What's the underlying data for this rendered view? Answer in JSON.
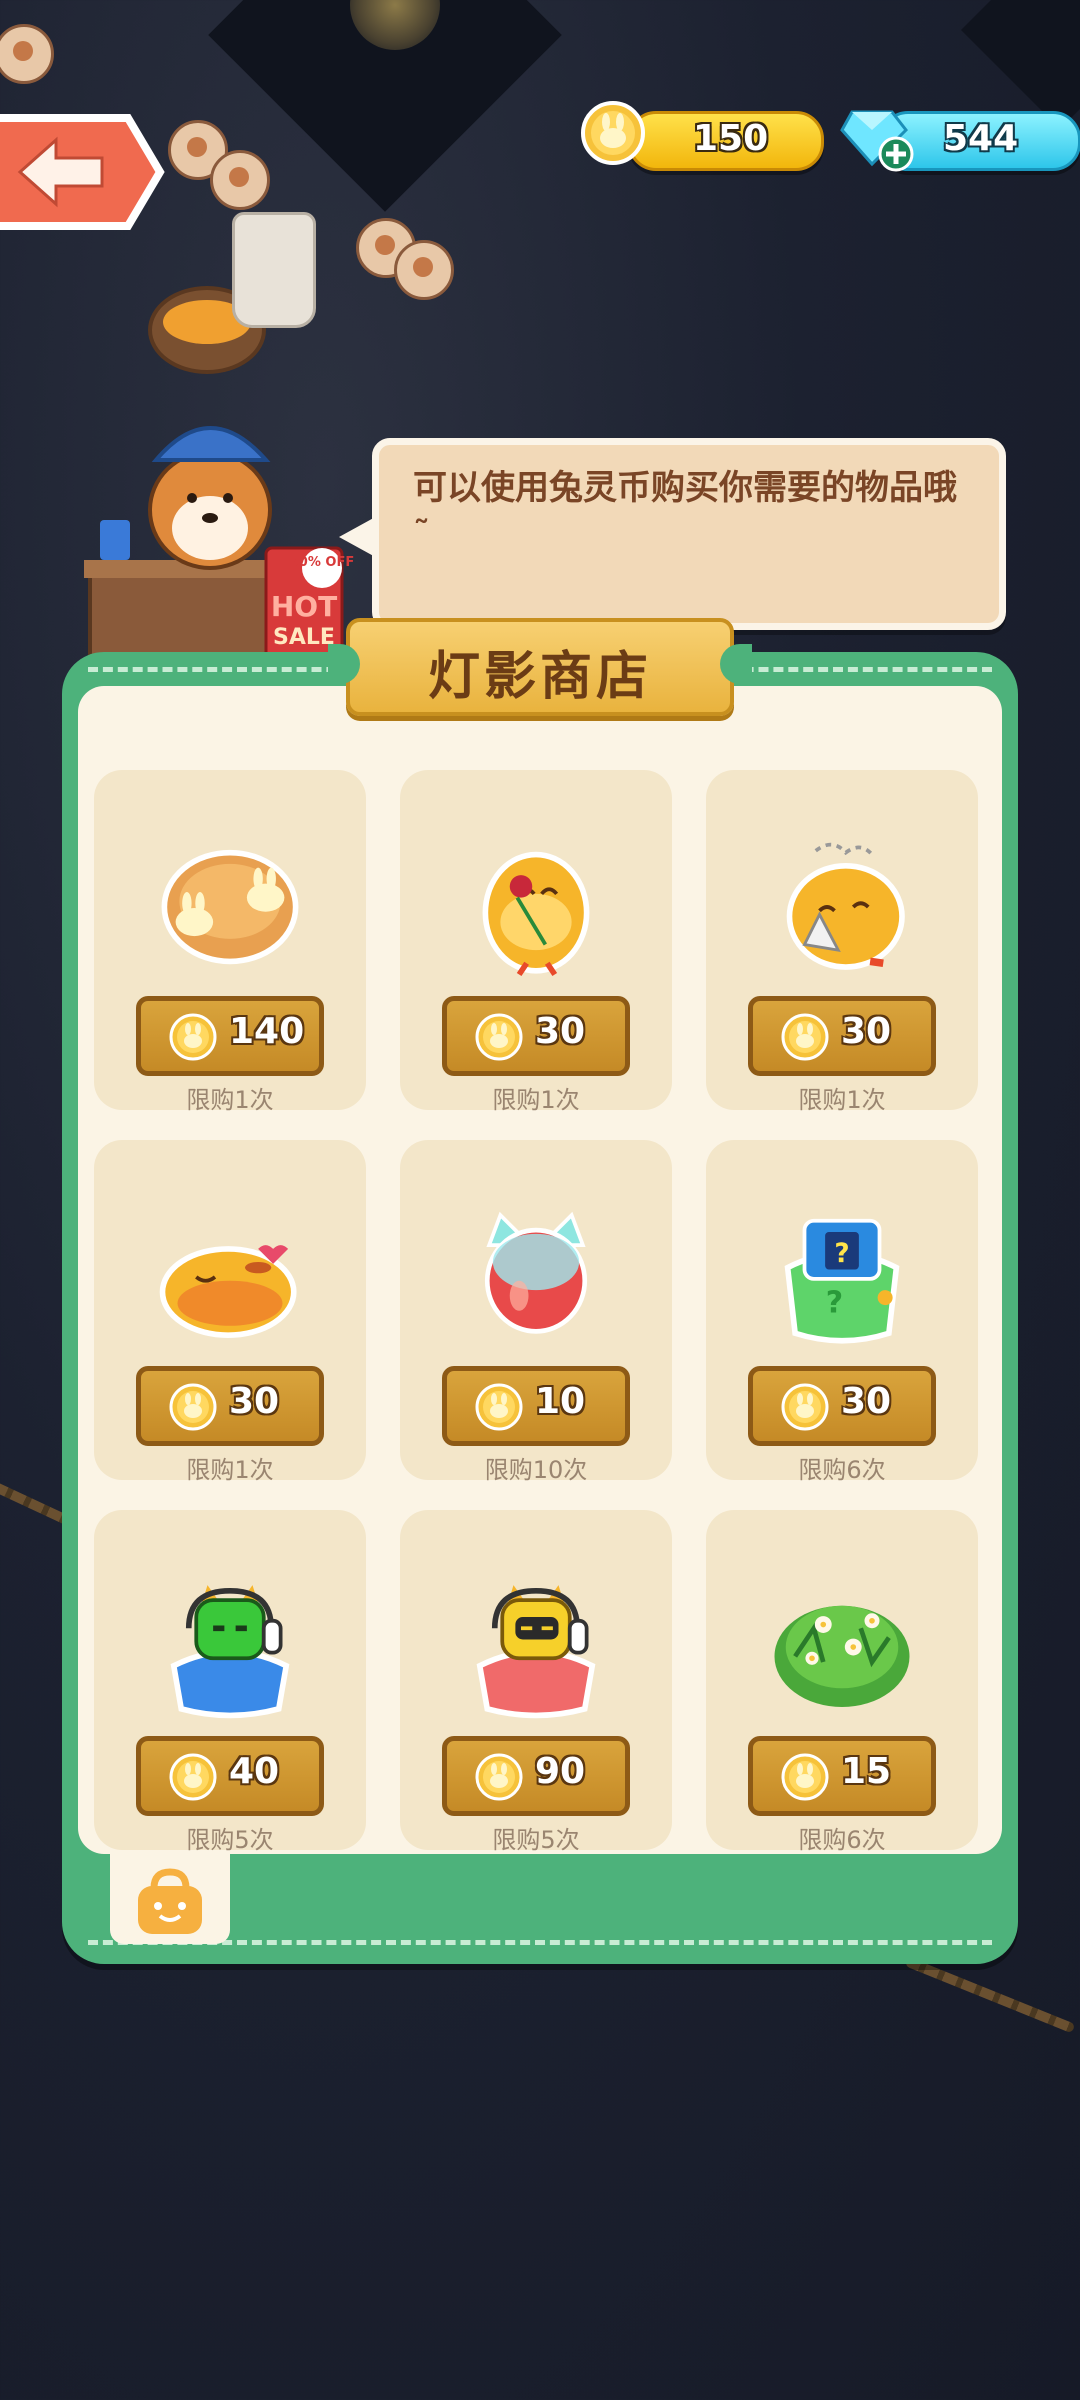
{
  "header": {
    "coins": "150",
    "gems": "544",
    "back_icon": "left-arrow-icon"
  },
  "shopkeeper": {
    "speech": "可以使用兔灵币购买你需要的物品哦˜",
    "sign": {
      "discount": "50% OFF",
      "hot": "HOT",
      "sale": "SALE"
    }
  },
  "shop": {
    "title": "灯影商店",
    "items": [
      {
        "name": "bunny-pancake",
        "price": "140",
        "limit": "限购1次"
      },
      {
        "name": "chick-with-rose",
        "price": "30",
        "limit": "限购1次"
      },
      {
        "name": "chick-with-tissue",
        "price": "30",
        "limit": "限购1次"
      },
      {
        "name": "sleeping-chick",
        "price": "30",
        "limit": "限购1次"
      },
      {
        "name": "cat-jelly",
        "price": "10",
        "limit": "限购10次"
      },
      {
        "name": "mystery-bag",
        "price": "30",
        "limit": "限购6次"
      },
      {
        "name": "green-robot-cat-bag",
        "price": "40",
        "limit": "限购5次"
      },
      {
        "name": "yellow-robot-cat-bag",
        "price": "90",
        "limit": "限购5次"
      },
      {
        "name": "flower-bush",
        "price": "15",
        "limit": "限购6次"
      }
    ]
  },
  "colors": {
    "panel": "#4db27b",
    "card": "#f3e6c9",
    "price_button": "#d9a43c",
    "back_button": "#f06a4f"
  }
}
